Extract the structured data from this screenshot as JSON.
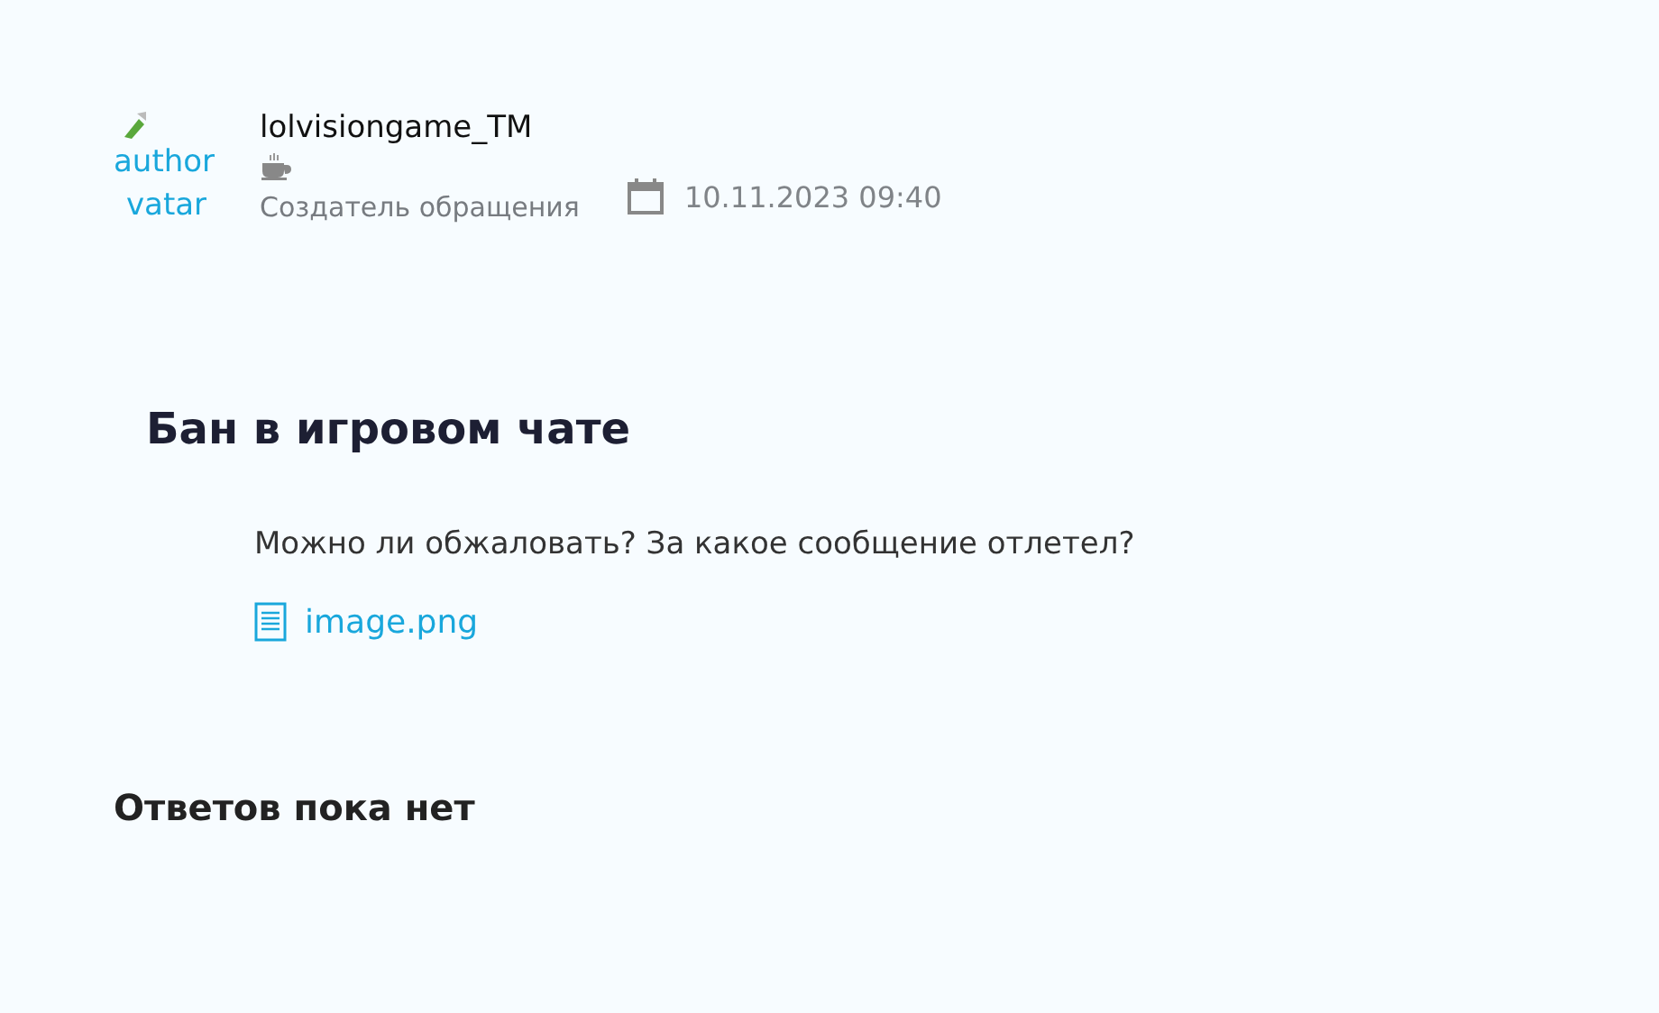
{
  "author": {
    "avatar_alt": [
      "author",
      "vatar"
    ],
    "name": "lolvisiongame_TM",
    "role": "Создатель обращения"
  },
  "date": "10.11.2023 09:40",
  "ticket": {
    "title": "Бан в игровом чате",
    "message": "Можно ли обжаловать? За какое сообщение отлетел?",
    "attachments": [
      "image.png"
    ]
  },
  "replies_heading": "Ответов пока нет"
}
